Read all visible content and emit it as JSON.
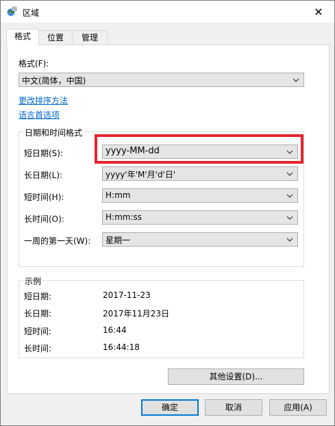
{
  "window": {
    "title": "区域",
    "close_symbol": "✕"
  },
  "tabs": [
    {
      "label": "格式",
      "active": true
    },
    {
      "label": "位置",
      "active": false
    },
    {
      "label": "管理",
      "active": false
    }
  ],
  "format": {
    "label": "格式(F):",
    "selected": "中文(简体，中国)",
    "link_sort": "更改排序方法",
    "link_language": "语言首选项"
  },
  "datetime": {
    "group_title": "日期和时间格式",
    "rows": [
      {
        "label": "短日期(S):",
        "value": "yyyy-MM-dd"
      },
      {
        "label": "长日期(L):",
        "value": "yyyy'年'M'月'd'日'"
      },
      {
        "label": "短时间(H):",
        "value": "H:mm"
      },
      {
        "label": "长时间(O):",
        "value": "H:mm:ss"
      },
      {
        "label": "一周的第一天(W):",
        "value": "星期一"
      }
    ]
  },
  "examples": {
    "group_title": "示例",
    "rows": [
      {
        "label": "短日期:",
        "value": "2017-11-23"
      },
      {
        "label": "长日期:",
        "value": "2017年11月23日"
      },
      {
        "label": "短时间:",
        "value": "16:44"
      },
      {
        "label": "长时间:",
        "value": "16:44:18"
      }
    ]
  },
  "buttons": {
    "other_settings": "其他设置(D)...",
    "ok": "确定",
    "cancel": "取消",
    "apply": "应用(A)"
  },
  "colors": {
    "accent": "#0078d7",
    "link": "#0066cc",
    "highlight": "#e8242d"
  }
}
